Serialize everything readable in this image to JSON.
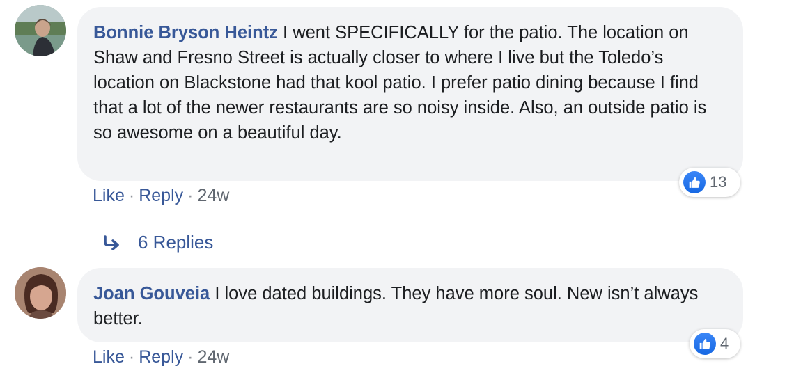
{
  "comments": [
    {
      "author": "Bonnie Bryson Heintz",
      "text": "I went SPECIFICALLY for the patio. The location on Shaw and Fresno Street is actually closer to where I live but the Toledo’s location on Blackstone had that kool patio. I prefer patio dining because I find that a lot of the newer restaurants are so noisy inside. Also, an outside patio is so awesome on a beautiful day.",
      "like_label": "Like",
      "reply_label": "Reply",
      "separator": "·",
      "age": "24w",
      "reaction_count": "13",
      "reaction_icon": "thumbs-up-icon",
      "replies_label": "6 Replies"
    },
    {
      "author": "Joan Gouveia",
      "text": "I love dated buildings. They have more soul. New isn’t always better.",
      "like_label": "Like",
      "reply_label": "Reply",
      "separator": "·",
      "age": "24w",
      "reaction_count": "4",
      "reaction_icon": "thumbs-up-icon"
    }
  ],
  "colors": {
    "author": "#385898",
    "bubble": "#f2f3f5",
    "like_badge": "#1877f2",
    "meta": "#606770"
  }
}
